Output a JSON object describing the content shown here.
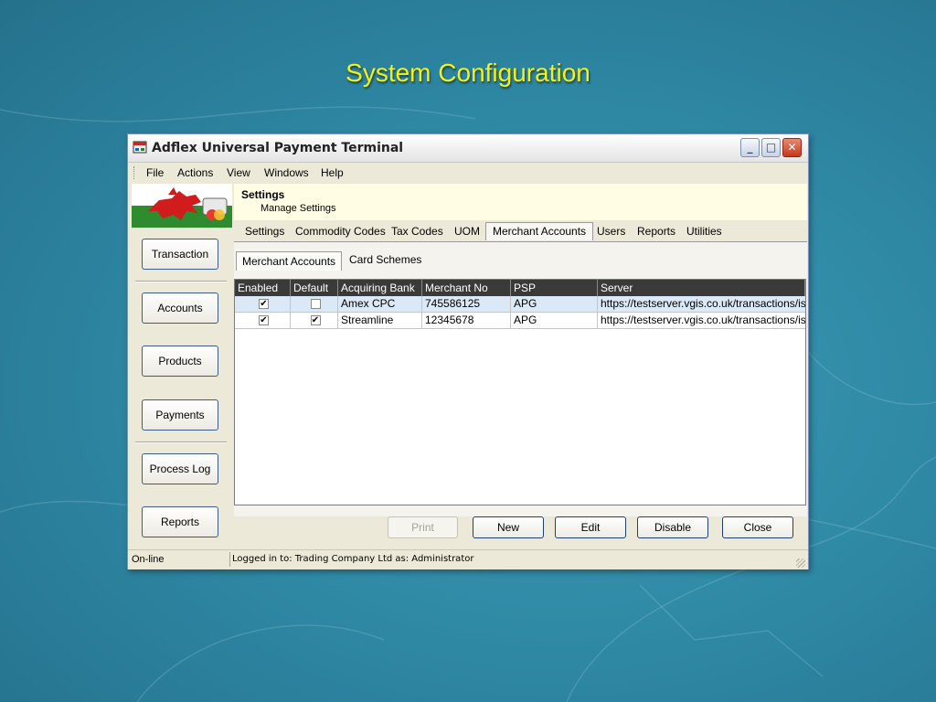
{
  "slide": {
    "title": "System Configuration"
  },
  "window": {
    "title": "Adflex Universal Payment Terminal",
    "controls": {
      "minimize": "_",
      "maximize": "□",
      "close": "✕"
    }
  },
  "menu": [
    "File",
    "Actions",
    "View",
    "Windows",
    "Help"
  ],
  "sidebar": {
    "buttons": [
      "Transaction",
      "Accounts",
      "Products",
      "Payments",
      "Process Log",
      "Reports"
    ]
  },
  "header": {
    "title": "Settings",
    "subtitle": "Manage Settings"
  },
  "tabs": {
    "items": [
      "Settings",
      "Commodity Codes",
      "Tax Codes",
      "UOM",
      "Merchant Accounts",
      "Users",
      "Reports",
      "Utilities"
    ],
    "active": "Merchant Accounts"
  },
  "subtabs": {
    "items": [
      "Merchant Accounts",
      "Card Schemes"
    ],
    "active": "Merchant Accounts"
  },
  "grid": {
    "columns": [
      "Enabled",
      "Default",
      "Acquiring Bank",
      "Merchant No",
      "PSP",
      "Server"
    ],
    "rows": [
      {
        "enabled": true,
        "default": false,
        "bank": "Amex CPC",
        "merchant_no": "745586125",
        "psp": "APG",
        "server": "https://testserver.vgis.co.uk/transactions/is"
      },
      {
        "enabled": true,
        "default": true,
        "bank": "Streamline",
        "merchant_no": "12345678",
        "psp": "APG",
        "server": "https://testserver.vgis.co.uk/transactions/is"
      }
    ]
  },
  "buttons": {
    "print": "Print",
    "new": "New",
    "edit": "Edit",
    "disable": "Disable",
    "close": "Close"
  },
  "status": {
    "connection": "On-line",
    "login": "Logged in to: Trading Company Ltd as: Administrator"
  },
  "colors": {
    "slide_title": "#f4f214",
    "grid_header_bg": "#3a3a3a",
    "selected_row": "#dbe8f6",
    "header_panel": "#fffde4"
  }
}
